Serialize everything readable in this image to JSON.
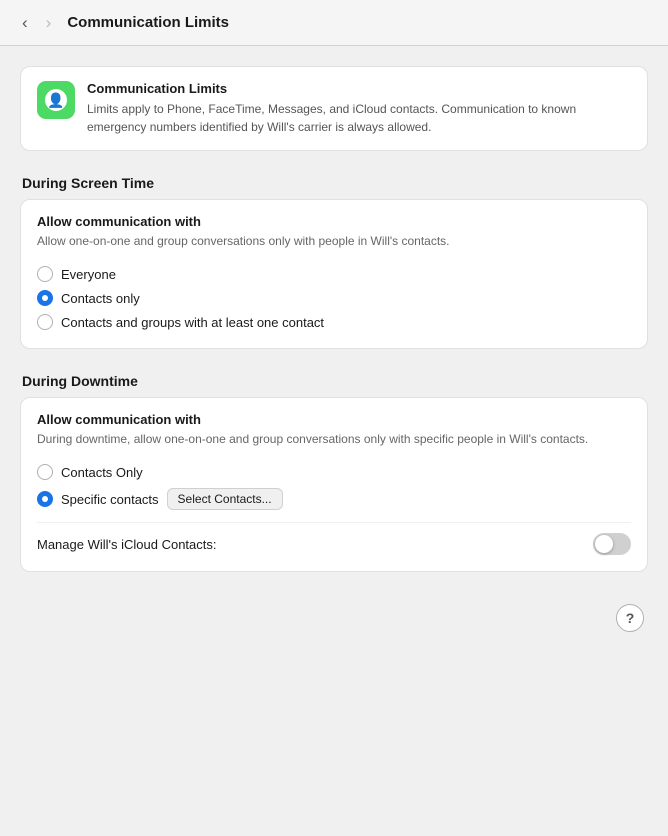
{
  "header": {
    "title": "Communication Limits",
    "back_label": "‹",
    "forward_label": "›"
  },
  "info_card": {
    "app_name": "Communication Limits",
    "description": "Limits apply to Phone, FaceTime, Messages, and iCloud contacts. Communication to known emergency numbers identified by Will's carrier is always allowed.",
    "icon_symbol": "👤"
  },
  "screen_time_section": {
    "header": "During Screen Time",
    "card_title": "Allow communication with",
    "card_desc": "Allow one-on-one and group conversations only with people in Will's contacts.",
    "options": [
      {
        "id": "st-everyone",
        "label": "Everyone",
        "selected": false
      },
      {
        "id": "st-contacts-only",
        "label": "Contacts only",
        "selected": true
      },
      {
        "id": "st-contacts-groups",
        "label": "Contacts and groups with at least one contact",
        "selected": false
      }
    ]
  },
  "downtime_section": {
    "header": "During Downtime",
    "card_title": "Allow communication with",
    "card_desc": "During downtime, allow one-on-one and group conversations only with specific people in Will's contacts.",
    "options": [
      {
        "id": "dt-contacts-only",
        "label": "Contacts Only",
        "selected": false
      },
      {
        "id": "dt-specific",
        "label": "Specific contacts",
        "selected": true
      }
    ],
    "select_contacts_btn": "Select Contacts...",
    "toggle_label": "Manage Will's iCloud Contacts:",
    "toggle_on": false
  },
  "help_btn_label": "?"
}
